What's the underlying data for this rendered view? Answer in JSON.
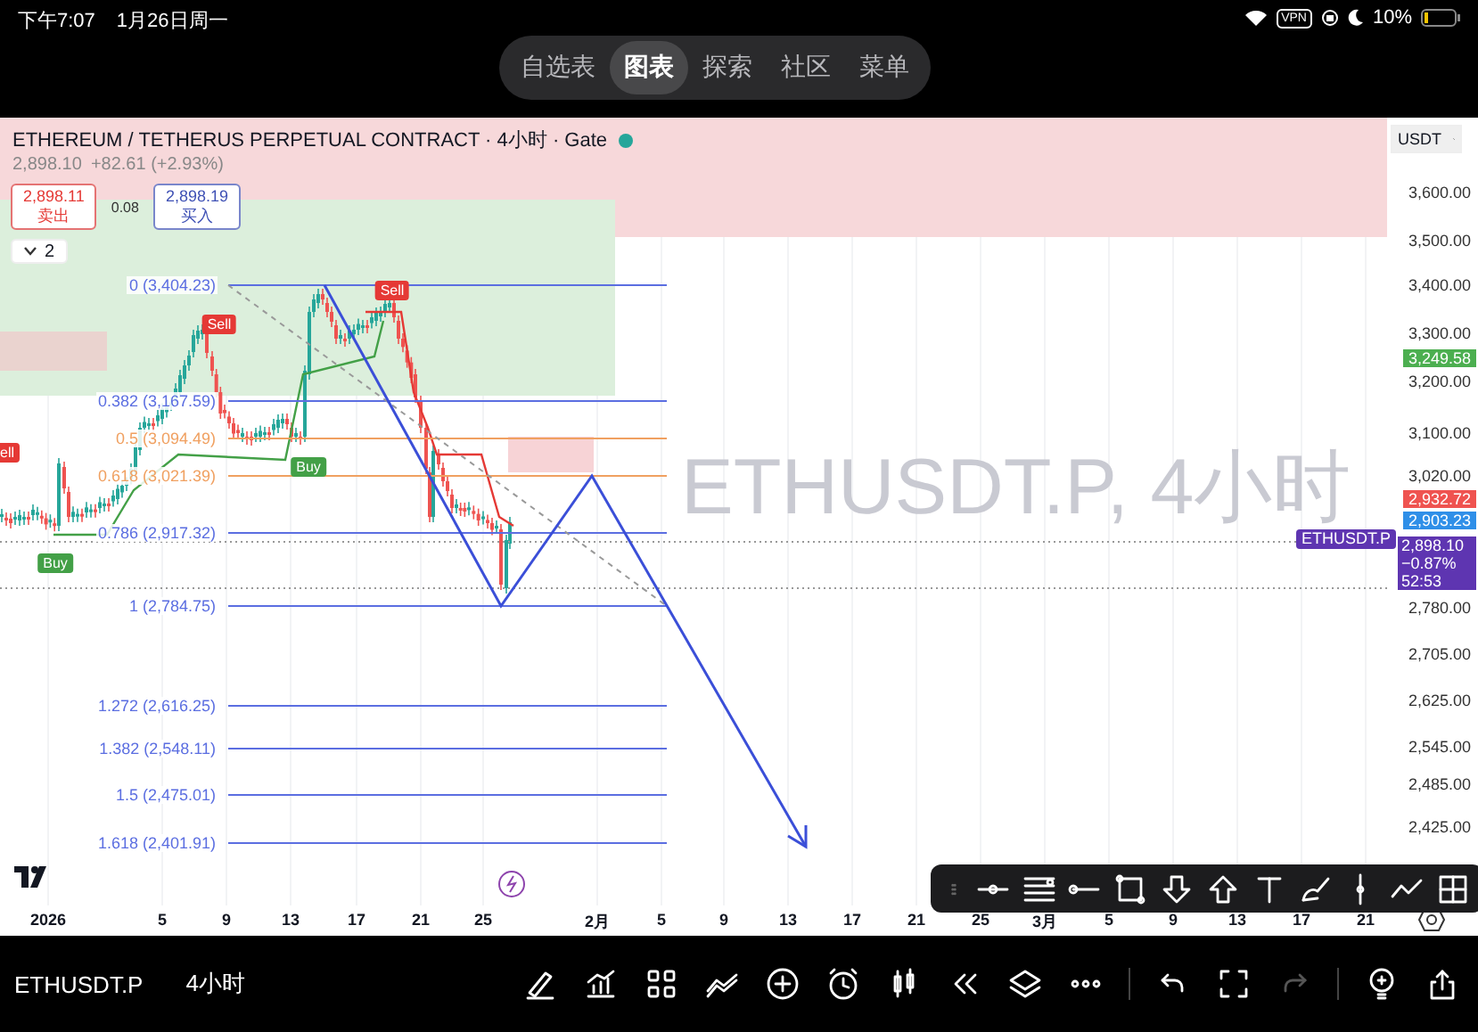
{
  "status_bar": {
    "time": "下午7:07",
    "date": "1月26日周一",
    "vpn": "VPN",
    "battery": "10%"
  },
  "tabs": [
    {
      "label": "自选表",
      "selected": false
    },
    {
      "label": "图表",
      "selected": true
    },
    {
      "label": "探索",
      "selected": false
    },
    {
      "label": "社区",
      "selected": false
    },
    {
      "label": "菜单",
      "selected": false
    }
  ],
  "chart": {
    "title": "ETHEREUM / TETHERUS PERPETUAL CONTRACT · 4小时 · Gate",
    "market_open": true,
    "price": "2,898.10",
    "change": "+82.61 (+2.93%)",
    "sell": {
      "price": "2,898.11",
      "label": "卖出"
    },
    "spread": "0.08",
    "buy": {
      "price": "2,898.19",
      "label": "买入"
    },
    "indicator_count": "2",
    "currency": "USDT",
    "watermark": "ETHUSDT.P, 4小时",
    "price_axis": [
      "3,600.00",
      "3,500.00",
      "3,400.00",
      "3,300.00",
      "3,200.00",
      "3,100.00",
      "3,020.00",
      "2,780.00",
      "2,705.00",
      "2,625.00",
      "2,545.00",
      "2,485.00",
      "2,425.00"
    ],
    "price_tags": [
      {
        "text": "3,249.58",
        "color": "#4caf50"
      },
      {
        "text": "2,932.72",
        "color": "#ef5350"
      },
      {
        "text": "2,903.23",
        "color": "#2f8fe8"
      }
    ],
    "symbol_tag": "ETHUSDT.P",
    "last_price": {
      "price": "2,898.10",
      "change": "−0.87%",
      "countdown": "52:53"
    },
    "fib_levels": [
      {
        "label": "0 (3,404.23)",
        "color": "#5b6ee1"
      },
      {
        "label": "0.382 (3,167.59)",
        "color": "#5b6ee1"
      },
      {
        "label": "0.5 (3,094.49)",
        "color": "#f0a060"
      },
      {
        "label": "0.618 (3,021.39)",
        "color": "#f0a060"
      },
      {
        "label": "0.786 (2,917.32)",
        "color": "#5b6ee1"
      },
      {
        "label": "1 (2,784.75)",
        "color": "#5b6ee1"
      },
      {
        "label": "1.272 (2,616.25)",
        "color": "#5b6ee1"
      },
      {
        "label": "1.382 (2,548.11)",
        "color": "#5b6ee1"
      },
      {
        "label": "1.5 (2,475.01)",
        "color": "#5b6ee1"
      },
      {
        "label": "1.618 (2,401.91)",
        "color": "#5b6ee1"
      }
    ],
    "signals": [
      {
        "label": "Sell",
        "kind": "sell"
      },
      {
        "label": "Sell",
        "kind": "sell"
      },
      {
        "label": "ell",
        "kind": "sell"
      },
      {
        "label": "Buy",
        "kind": "buy"
      },
      {
        "label": "Buy",
        "kind": "buy"
      }
    ],
    "time_axis": [
      "2026",
      "5",
      "9",
      "13",
      "17",
      "21",
      "25",
      "2月",
      "5",
      "9",
      "13",
      "17",
      "21",
      "25",
      "3月",
      "5",
      "9",
      "13",
      "17",
      "21"
    ]
  },
  "bottom_bar": {
    "symbol": "ETHUSDT.P",
    "interval": "4小时",
    "redo_disabled": true
  }
}
